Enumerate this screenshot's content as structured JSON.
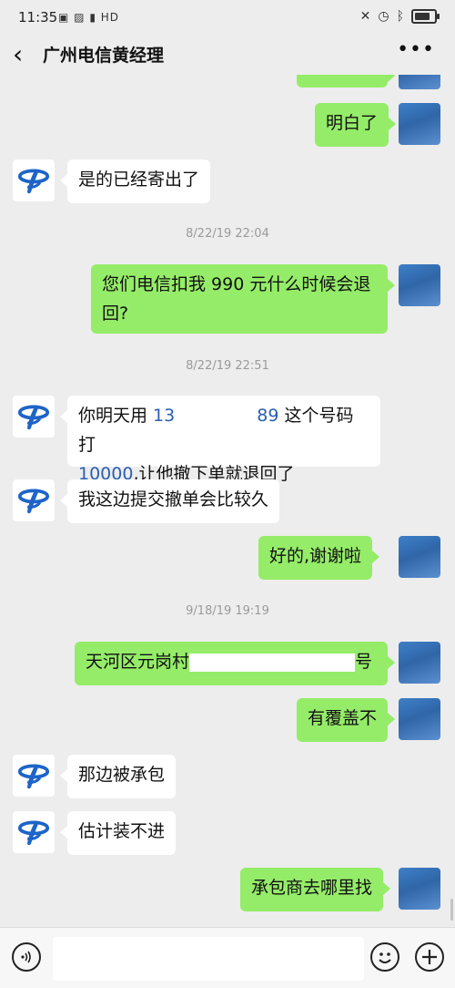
{
  "status_bar": {
    "time": "11:35",
    "network": "HD"
  },
  "header": {
    "title": "广州电信黄经理",
    "back_icon": "chevron-left-icon",
    "more_icon": "more-dots-icon"
  },
  "messages": [
    {
      "type": "out",
      "text": "明白了"
    },
    {
      "type": "in",
      "text": "是的已经寄出了"
    },
    {
      "type": "time",
      "text": "8/22/19 22:04"
    },
    {
      "type": "out",
      "line1": "您们电信扣我 990 元什么时候会退",
      "line2": "回?"
    },
    {
      "type": "time",
      "text": "8/22/19 22:51"
    },
    {
      "type": "in",
      "prefix": "你明天用 ",
      "phone_start": "13",
      "phone_end": "89",
      "suffix": "这个号码打",
      "line2_phone": "10000",
      "line2_rest": ",让他撤下单就退回了"
    },
    {
      "type": "in",
      "text": "我这边提交撤单会比较久"
    },
    {
      "type": "out",
      "text": "好的,谢谢啦"
    },
    {
      "type": "time",
      "text": "9/18/19 19:19"
    },
    {
      "type": "out",
      "prefix": "天河区元岗村",
      "suffix": "号"
    },
    {
      "type": "out",
      "text": "有覆盖不"
    },
    {
      "type": "in",
      "text": "那边被承包"
    },
    {
      "type": "in",
      "text": "估计装不进"
    },
    {
      "type": "out",
      "text": "承包商去哪里找"
    }
  ],
  "input_bar": {
    "placeholder": "",
    "voice_icon": "voice-icon",
    "emoji_icon": "emoji-icon",
    "plus_icon": "plus-icon"
  },
  "colors": {
    "outgoing_bubble": "#95ec69",
    "incoming_bubble": "#ffffff",
    "background": "#ededed",
    "telecom_blue": "#1e64c8"
  }
}
